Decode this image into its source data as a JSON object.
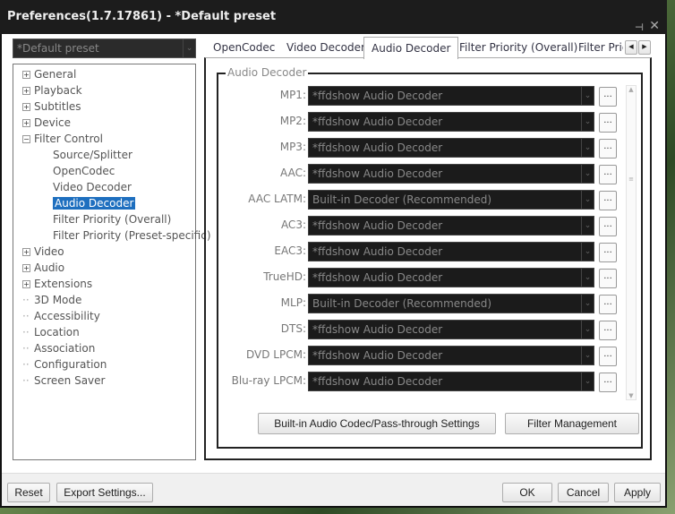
{
  "window": {
    "title": "Preferences(1.7.17861) - *Default preset"
  },
  "preset": {
    "value": "*Default preset"
  },
  "tree": [
    {
      "label": "General",
      "level": 0,
      "expander": "+"
    },
    {
      "label": "Playback",
      "level": 0,
      "expander": "+"
    },
    {
      "label": "Subtitles",
      "level": 0,
      "expander": "+"
    },
    {
      "label": "Device",
      "level": 0,
      "expander": "+"
    },
    {
      "label": "Filter Control",
      "level": 0,
      "expander": "-"
    },
    {
      "label": "Source/Splitter",
      "level": 1
    },
    {
      "label": "OpenCodec",
      "level": 1
    },
    {
      "label": "Video Decoder",
      "level": 1
    },
    {
      "label": "Audio Decoder",
      "level": 1,
      "selected": true
    },
    {
      "label": "Filter Priority (Overall)",
      "level": 1
    },
    {
      "label": "Filter Priority (Preset-specific)",
      "level": 1
    },
    {
      "label": "Video",
      "level": 0,
      "expander": "+"
    },
    {
      "label": "Audio",
      "level": 0,
      "expander": "+"
    },
    {
      "label": "Extensions",
      "level": 0,
      "expander": "+"
    },
    {
      "label": "3D Mode",
      "level": 0
    },
    {
      "label": "Accessibility",
      "level": 0
    },
    {
      "label": "Location",
      "level": 0
    },
    {
      "label": "Association",
      "level": 0
    },
    {
      "label": "Configuration",
      "level": 0
    },
    {
      "label": "Screen Saver",
      "level": 0
    }
  ],
  "tabs": [
    "OpenCodec",
    "Video Decoder",
    "Audio Decoder",
    "Filter Priority (Overall)",
    "Filter Prio"
  ],
  "group": {
    "title": "Audio Decoder",
    "more_label": "...",
    "rows": [
      {
        "label": "MP1:",
        "value": "*ffdshow Audio Decoder"
      },
      {
        "label": "MP2:",
        "value": "*ffdshow Audio Decoder"
      },
      {
        "label": "MP3:",
        "value": "*ffdshow Audio Decoder"
      },
      {
        "label": "AAC:",
        "value": "*ffdshow Audio Decoder"
      },
      {
        "label": "AAC LATM:",
        "value": "Built-in Decoder (Recommended)"
      },
      {
        "label": "AC3:",
        "value": "*ffdshow Audio Decoder"
      },
      {
        "label": "EAC3:",
        "value": "*ffdshow Audio Decoder"
      },
      {
        "label": "TrueHD:",
        "value": "*ffdshow Audio Decoder"
      },
      {
        "label": "MLP:",
        "value": "Built-in Decoder (Recommended)"
      },
      {
        "label": "DTS:",
        "value": "*ffdshow Audio Decoder"
      },
      {
        "label": "DVD LPCM:",
        "value": "*ffdshow Audio Decoder"
      },
      {
        "label": "Blu-ray LPCM:",
        "value": "*ffdshow Audio Decoder"
      }
    ]
  },
  "buttons": {
    "builtin": "Built-in Audio Codec/Pass-through Settings",
    "filter_mgmt": "Filter Management",
    "reset": "Reset",
    "export": "Export Settings...",
    "ok": "OK",
    "cancel": "Cancel",
    "apply": "Apply"
  }
}
